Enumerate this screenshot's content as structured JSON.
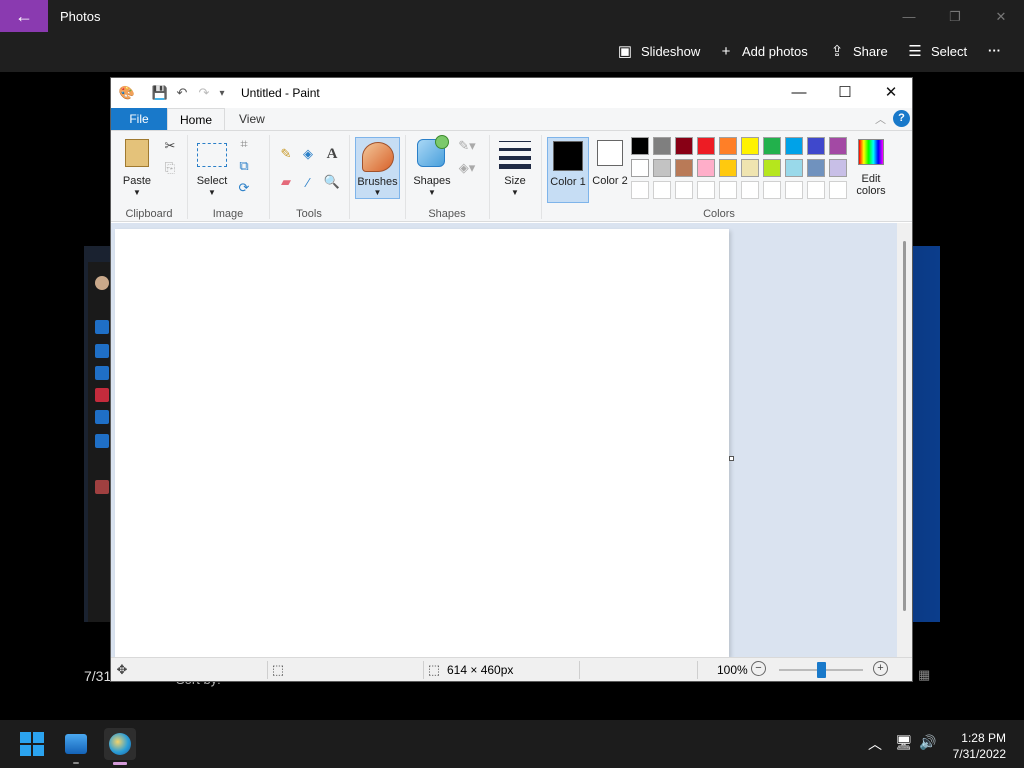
{
  "photos": {
    "title": "Photos",
    "toolbar": {
      "slideshow": "Slideshow",
      "add_photos": "Add photos",
      "share": "Share",
      "select": "Select",
      "more": "···"
    },
    "footer": {
      "date": "7/31",
      "sort": "Sort by:"
    }
  },
  "paint": {
    "title": "Untitled - Paint",
    "tabs": {
      "file": "File",
      "home": "Home",
      "view": "View"
    },
    "help": "?",
    "ribbon": {
      "clipboard": {
        "paste": "Paste",
        "group": "Clipboard"
      },
      "image": {
        "select": "Select",
        "group": "Image"
      },
      "tools": {
        "group": "Tools"
      },
      "brushes": "Brushes",
      "shapes": {
        "label": "Shapes",
        "group": "Shapes"
      },
      "size": "Size",
      "color1": "Color 1",
      "color2": "Color 2",
      "edit_colors": "Edit colors",
      "colors_group": "Colors"
    },
    "palette": {
      "row1": [
        "#000000",
        "#7f7f7f",
        "#880015",
        "#ed1c24",
        "#ff7f27",
        "#fff200",
        "#22b14c",
        "#00a2e8",
        "#3f48cc",
        "#a349a4"
      ],
      "row2": [
        "#ffffff",
        "#c3c3c3",
        "#b97a57",
        "#ffaec9",
        "#ffc90e",
        "#efe4b0",
        "#b5e61d",
        "#99d9ea",
        "#7092be",
        "#c8bfe7"
      ],
      "row3": [
        "#ffffff",
        "#ffffff",
        "#ffffff",
        "#ffffff",
        "#ffffff",
        "#ffffff",
        "#ffffff",
        "#ffffff",
        "#ffffff",
        "#ffffff"
      ],
      "color1": "#000000",
      "color2": "#ffffff"
    },
    "status": {
      "canvas_size": "614 × 460px",
      "zoom": "100%",
      "zoom_level": 1.0
    }
  },
  "taskbar": {
    "time": "1:28 PM",
    "date": "7/31/2022"
  }
}
